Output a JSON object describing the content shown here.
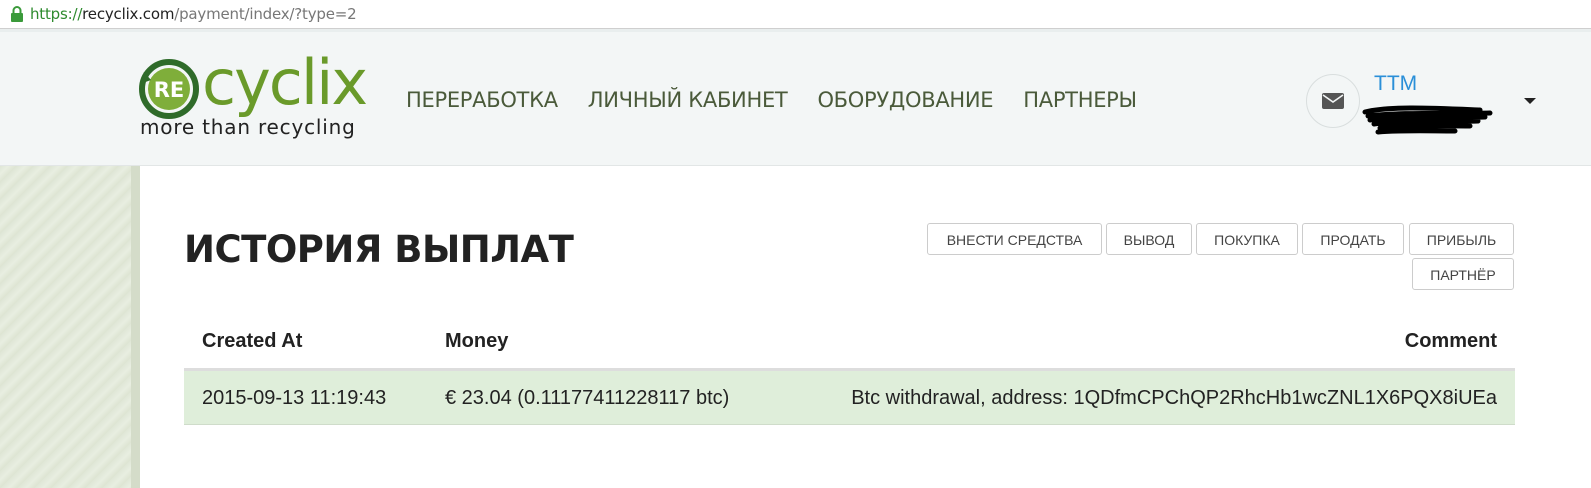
{
  "browser": {
    "url_scheme": "https://",
    "url_host": "recyclix.com",
    "url_path": "/payment/index/?type=2"
  },
  "header": {
    "logo": {
      "badge": "RE",
      "word": "cyclix",
      "tagline": "more than recycling"
    },
    "nav": [
      {
        "label": "ПЕРЕРАБОТКА"
      },
      {
        "label": "ЛИЧНЫЙ КАБИНЕТ"
      },
      {
        "label": "ОБОРУДОВАНИЕ"
      },
      {
        "label": "ПАРТНЕРЫ"
      }
    ],
    "user": {
      "name": "TTM",
      "mail_icon": "envelope-icon",
      "dropdown_icon": "caret-down-icon"
    }
  },
  "page": {
    "title": "ИСТОРИЯ ВЫПЛАТ",
    "buttons": [
      {
        "label": "ВНЕСТИ СРЕДСТВА"
      },
      {
        "label": "ВЫВОД"
      },
      {
        "label": "ПОКУПКА"
      },
      {
        "label": "ПРОДАТЬ"
      },
      {
        "label": "ПРИБЫЛЬ"
      },
      {
        "label": "ПАРТНЁР"
      }
    ]
  },
  "table": {
    "columns": [
      "Created At",
      "Money",
      "Comment"
    ],
    "rows": [
      {
        "created_at": "2015-09-13 11:19:43",
        "money": "€ 23.04 (0.11177411228117 btc)",
        "comment": "Btc withdrawal, address: 1QDfmCPChQP2RhcHb1wcZNL1X6PQX8iUEa"
      }
    ]
  },
  "colors": {
    "brand_green": "#6a9a2a",
    "user_link": "#2a8fd8",
    "row_highlight": "#dfeeda"
  }
}
